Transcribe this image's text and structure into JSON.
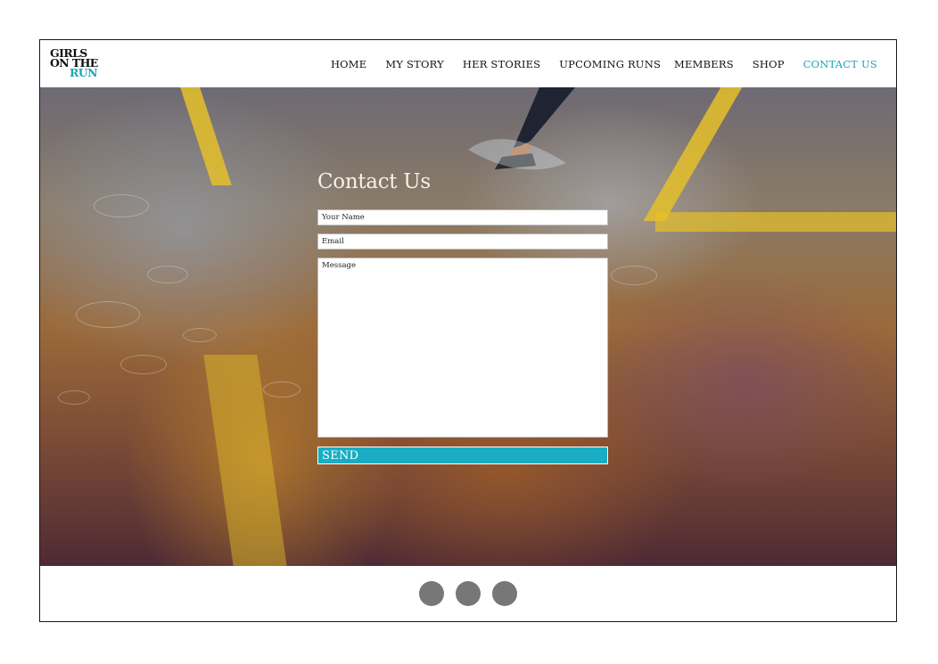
{
  "brand": {
    "logo_line1": "GIRLS",
    "logo_line2": "ON THE",
    "logo_line3": "RUN",
    "accent_color": "#1aa6b8"
  },
  "nav": {
    "items": [
      {
        "label": "HOME",
        "active": false
      },
      {
        "label": "MY STORY",
        "active": false
      },
      {
        "label": "HER STORIES",
        "active": false
      },
      {
        "label": "UPCOMING RUNS",
        "active": false
      },
      {
        "label": "MEMBERS",
        "active": false
      },
      {
        "label": "SHOP",
        "active": false
      },
      {
        "label": "CONTACT US",
        "active": true
      }
    ]
  },
  "contact_form": {
    "title": "Contact Us",
    "name_placeholder": "Your Name",
    "email_placeholder": "Email",
    "message_placeholder": "Message",
    "send_label": "SEND",
    "send_color": "#18adc3"
  },
  "footer": {
    "dots": [
      "dot-1",
      "dot-2",
      "dot-3"
    ],
    "dot_color": "#777777"
  }
}
